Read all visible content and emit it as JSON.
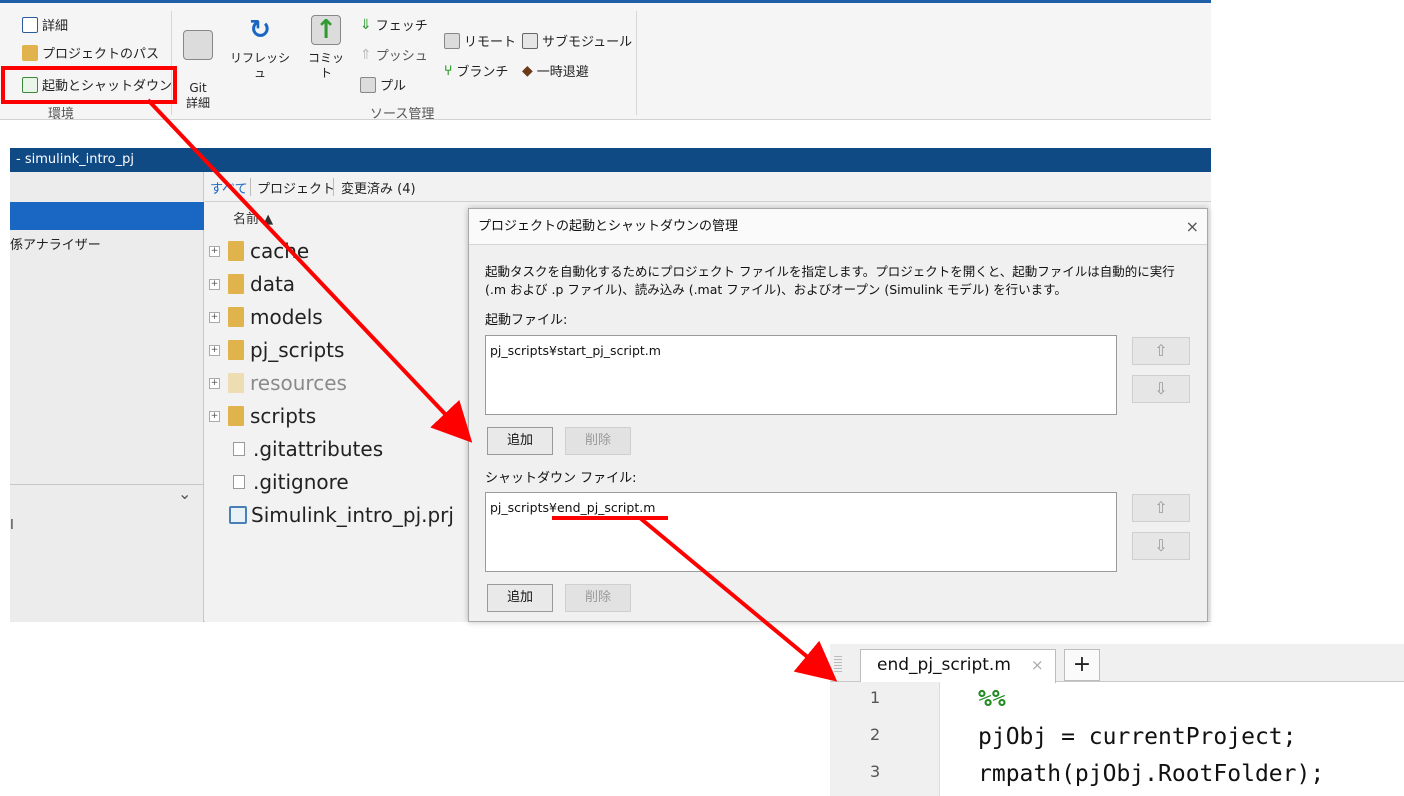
{
  "ribbon": {
    "environment": {
      "details_label": "詳細",
      "project_path_label": "プロジェクトのパス",
      "startup_shutdown_label": "起動とシャットダウン",
      "section_label": "環境"
    },
    "source_control": {
      "git_details_label": "Git\n詳細",
      "refresh_label": "リフレッシュ",
      "commit_label": "コミット",
      "fetch_label": "フェッチ",
      "push_label": "プッシュ",
      "pull_label": "プル",
      "remote_label": "リモート",
      "branch_label": "ブランチ",
      "submodule_label": "サブモジュール",
      "stash_label": "一時退避",
      "section_label": "ソース管理"
    }
  },
  "project": {
    "title": "- simulink_intro_pj",
    "left_text": "係アナライザー",
    "left_mark": "I",
    "tabs": [
      "すべて",
      "プロジェクト",
      "変更済み (4)"
    ],
    "column_header": "名前 ▲",
    "files": [
      {
        "name": "cache",
        "kind": "folder"
      },
      {
        "name": "data",
        "kind": "folder"
      },
      {
        "name": "models",
        "kind": "folder"
      },
      {
        "name": "pj_scripts",
        "kind": "folder"
      },
      {
        "name": "resources",
        "kind": "folder-dim"
      },
      {
        "name": "scripts",
        "kind": "folder"
      },
      {
        "name": ".gitattributes",
        "kind": "file"
      },
      {
        "name": ".gitignore",
        "kind": "file"
      },
      {
        "name": "Simulink_intro_pj.prj",
        "kind": "prj"
      }
    ]
  },
  "dialog": {
    "title": "プロジェクトの起動とシャットダウンの管理",
    "close": "×",
    "description": "起動タスクを自動化するためにプロジェクト ファイルを指定します。プロジェクトを開くと、起動ファイルは自動的に実行 (.m および .p ファイル)、読み込み (.mat ファイル)、およびオープン (Simulink モデル) を行います。",
    "startup_label": "起動ファイル:",
    "startup_file": "pj_scripts¥start_pj_script.m",
    "shutdown_label": "シャットダウン ファイル:",
    "shutdown_file": "pj_scripts¥end_pj_script.m",
    "add_label": "追加",
    "remove_label": "削除",
    "up_glyph": "⇧",
    "down_glyph": "⇩"
  },
  "editor": {
    "tab_label": "end_pj_script.m",
    "tab_close": "×",
    "add_tab": "+",
    "lines": [
      {
        "num": "1",
        "text": "%%"
      },
      {
        "num": "2",
        "text": "pjObj = currentProject;"
      },
      {
        "num": "3",
        "text": "rmpath(pjObj.RootFolder);"
      }
    ]
  },
  "colors": {
    "annotation": "#ff0000",
    "title_bar": "#0f4a85",
    "selection": "#1a67c3",
    "comment": "#228b22"
  }
}
